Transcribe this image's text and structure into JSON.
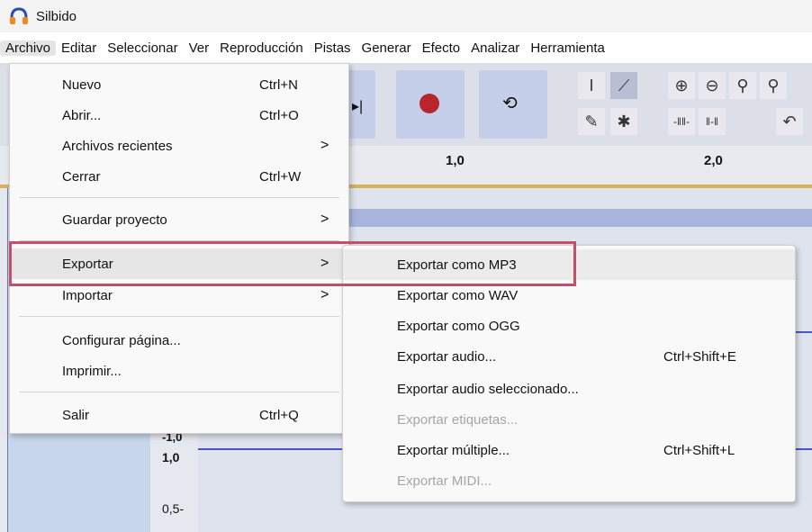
{
  "app": {
    "title": "Silbido",
    "icon": "headphones-icon"
  },
  "menubar": [
    {
      "label": "Archivo",
      "active": true
    },
    {
      "label": "Editar"
    },
    {
      "label": "Seleccionar"
    },
    {
      "label": "Ver"
    },
    {
      "label": "Reproducción"
    },
    {
      "label": "Pistas"
    },
    {
      "label": "Generar"
    },
    {
      "label": "Efecto"
    },
    {
      "label": "Analizar"
    },
    {
      "label": "Herramienta"
    }
  ],
  "ruler": {
    "labels": [
      "1,0",
      "2,0"
    ]
  },
  "track": {
    "scale_labels": [
      "-1,0",
      "1,0",
      "0,5-"
    ]
  },
  "file_menu": {
    "items": [
      {
        "label": "Nuevo",
        "shortcut": "Ctrl+N"
      },
      {
        "label": "Abrir...",
        "shortcut": "Ctrl+O"
      },
      {
        "label": "Archivos recientes",
        "arrow": ">"
      },
      {
        "label": "Cerrar",
        "shortcut": "Ctrl+W"
      },
      {
        "label": "Guardar proyecto",
        "arrow": ">"
      },
      {
        "label": "Exportar",
        "arrow": ">"
      },
      {
        "label": "Importar",
        "arrow": ">"
      },
      {
        "label": "Configurar página..."
      },
      {
        "label": "Imprimir..."
      },
      {
        "label": "Salir",
        "shortcut": "Ctrl+Q"
      }
    ]
  },
  "export_submenu": {
    "items": [
      {
        "label": "Exportar como MP3"
      },
      {
        "label": "Exportar como WAV"
      },
      {
        "label": "Exportar como OGG"
      },
      {
        "label": "Exportar audio...",
        "shortcut": "Ctrl+Shift+E"
      },
      {
        "label": "Exportar audio seleccionado..."
      },
      {
        "label": "Exportar etiquetas...",
        "disabled": true
      },
      {
        "label": "Exportar múltiple...",
        "shortcut": "Ctrl+Shift+L"
      },
      {
        "label": "Exportar MIDI...",
        "disabled": true
      }
    ]
  },
  "colors": {
    "highlight_border": "#c2506a",
    "record": "#b8262c",
    "waveform": "#4a55c6"
  }
}
